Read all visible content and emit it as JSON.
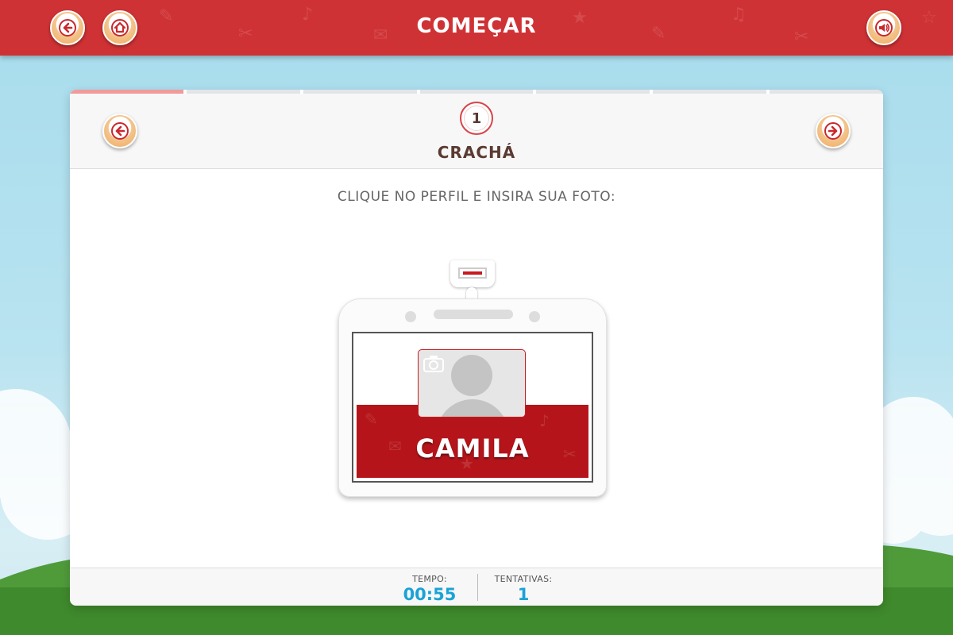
{
  "header": {
    "title": "COMEÇAR",
    "back_icon": "back-arrow-icon",
    "home_icon": "home-icon",
    "sound_icon": "speaker-icon"
  },
  "progress": {
    "segments": 7,
    "active": 1
  },
  "step": {
    "number": "1",
    "title": "CRACHÁ",
    "prev_icon": "prev-arrow-icon",
    "next_icon": "next-arrow-icon"
  },
  "instruction": "CLIQUE NO PERFIL E INSIRA SUA FOTO:",
  "badge": {
    "name": "CAMILA",
    "photo_icon": "camera-icon"
  },
  "footer": {
    "time_label": "TEMPO:",
    "time_value": "00:55",
    "attempts_label": "TENTATIVAS:",
    "attempts_value": "1"
  },
  "colors": {
    "header_red": "#cf3235",
    "badge_red": "#b5151a",
    "accent_orange": "#f0a85a",
    "stat_blue": "#1aa3d6",
    "title_brown": "#5a3a32"
  }
}
